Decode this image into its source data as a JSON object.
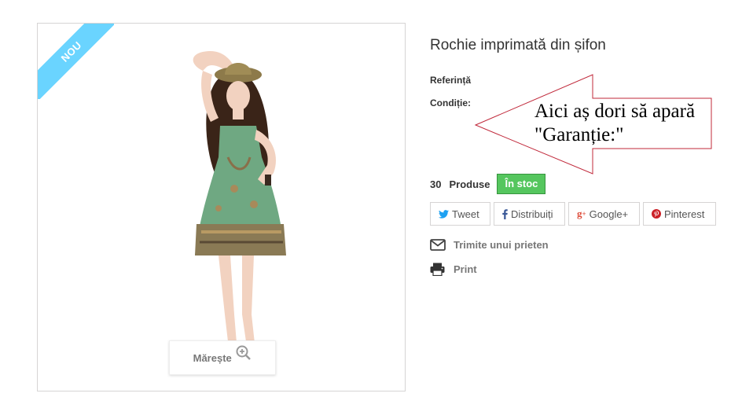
{
  "badge": {
    "new_label": "NOU",
    "color": "#6ad4ff"
  },
  "zoom": {
    "label": "Mărește",
    "icon": "zoom-in-icon"
  },
  "product": {
    "title": "Rochie imprimată din șifon",
    "reference_label": "Referință",
    "condition_label": "Condiție:"
  },
  "annotation": {
    "line1": "Aici aș dori să apară",
    "line2": "\"Garanție:\"",
    "outline_color": "#c0283a"
  },
  "stock": {
    "quantity": "30",
    "quantity_label": "Produse",
    "status": "În stoc",
    "status_color": "#55c65e"
  },
  "share": [
    {
      "label": "Tweet",
      "icon": "twitter-icon",
      "color": "#1da1f2"
    },
    {
      "label": "Distribuiți",
      "icon": "facebook-icon",
      "color": "#3b5998"
    },
    {
      "label": "Google+",
      "icon": "google-plus-icon",
      "color": "#dd4b39"
    },
    {
      "label": "Pinterest",
      "icon": "pinterest-icon",
      "color": "#cb2027"
    }
  ],
  "links": {
    "send_friend": "Trimite unui prieten",
    "print": "Print"
  }
}
